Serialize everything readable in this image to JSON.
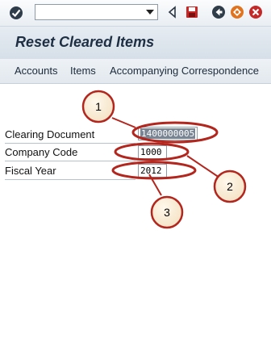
{
  "screen": {
    "title": "Reset Cleared Items"
  },
  "toolbar": {
    "command_field_value": "",
    "icons": [
      "enter-check-icon",
      "dropdown-arrow-icon",
      "back-triangle-icon",
      "save-icon",
      "back-icon",
      "exit-icon",
      "cancel-icon"
    ]
  },
  "menu": {
    "items": [
      "Accounts",
      "Items",
      "Accompanying Correspondence"
    ]
  },
  "fields": {
    "clearing_document": {
      "label": "Clearing Document",
      "value": "1400000005"
    },
    "company_code": {
      "label": "Company Code",
      "value": "1000"
    },
    "fiscal_year": {
      "label": "Fiscal Year",
      "value": "2012"
    }
  },
  "annotations": {
    "callouts": [
      "1",
      "2",
      "3"
    ],
    "color": "#b3261e"
  }
}
